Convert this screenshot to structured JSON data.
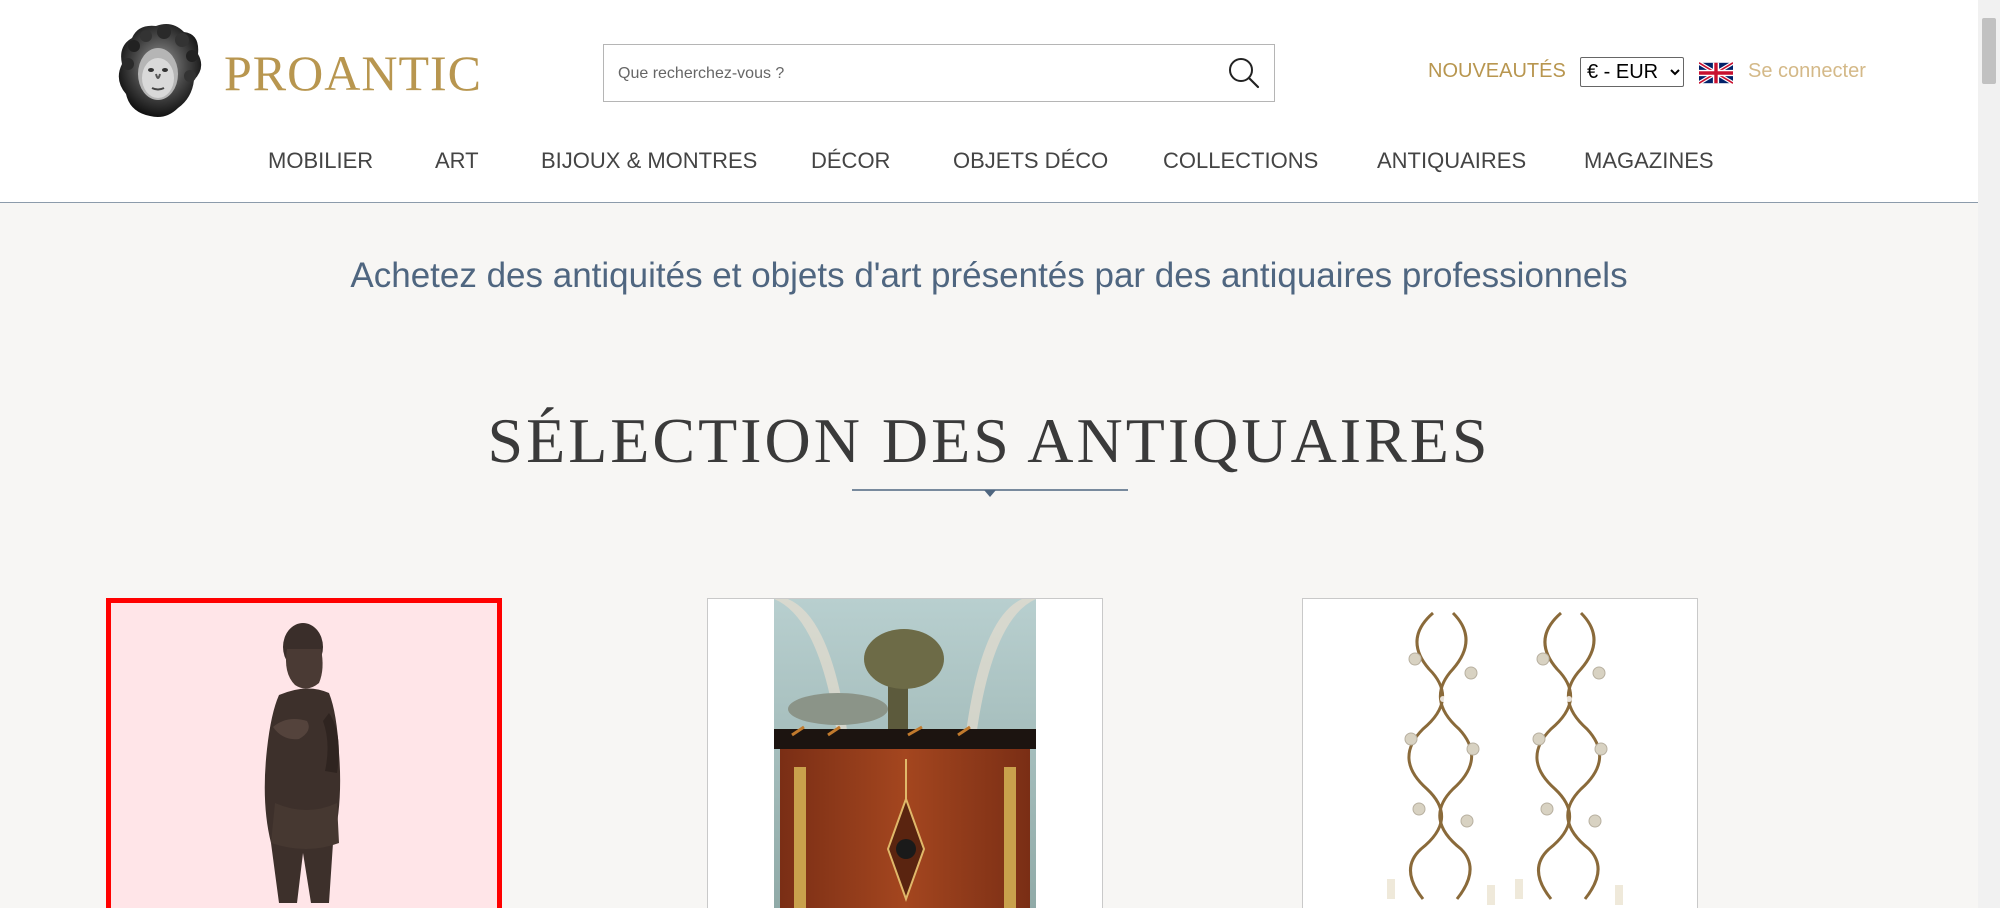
{
  "brand": {
    "name": "PROANTIC"
  },
  "search": {
    "placeholder": "Que recherchez-vous ?"
  },
  "header_links": {
    "new_label": "NOUVEAUTÉS",
    "currency_selected": "€ - EUR",
    "login_label": "Se connecter"
  },
  "nav": {
    "items": [
      {
        "label": "MOBILIER"
      },
      {
        "label": "ART"
      },
      {
        "label": "BIJOUX & MONTRES"
      },
      {
        "label": "DÉCOR"
      },
      {
        "label": "OBJETS DÉCO"
      },
      {
        "label": "COLLECTIONS"
      },
      {
        "label": "ANTIQUAIRES"
      },
      {
        "label": "MAGAZINES"
      }
    ]
  },
  "main": {
    "tagline": "Achetez des antiquités et objets d'art présentés par des antiquaires professionnels",
    "section_title": "SÉLECTION DES ANTIQUAIRES"
  },
  "icons": {
    "logo": "bust-logo-icon",
    "search": "search-icon",
    "flag": "uk-flag-icon"
  },
  "colors": {
    "brand_gold": "#b8964f",
    "login_gold": "#d4b988",
    "tagline_blue": "#4f6680",
    "selection_red": "#ff0000",
    "page_background": "#f7f6f4"
  }
}
